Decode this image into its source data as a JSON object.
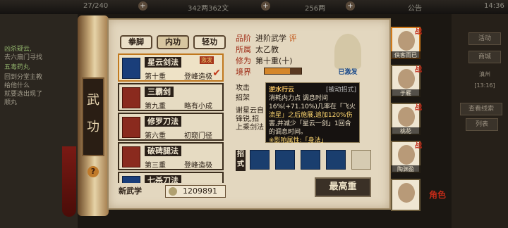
{
  "topbar": {
    "stamina": "27/240",
    "silver": "342两362文",
    "gold": "256两",
    "announce": "公告",
    "time": "14:36"
  },
  "left_quest": {
    "line1": "凶杀疑云,",
    "line2": "去六扇门寻找",
    "line3": "五毒药丸",
    "line4": "回到分堂主教",
    "line5": "给他什么",
    "line6": "就要选出现了",
    "line7": "顺丸"
  },
  "right_menu": {
    "btn1": "活动",
    "btn2": "商城",
    "btn3": "背包",
    "btn4": "查看线索",
    "btn5": "列表",
    "time": "[13:16]",
    "region": "滇州"
  },
  "scroll": {
    "title": "武功",
    "help": "?"
  },
  "tabs": [
    "拳脚",
    "内功",
    "轻功"
  ],
  "skills": [
    {
      "name": "星云剑法",
      "tier": "第十重",
      "status": "登峰造极",
      "tag": "激发",
      "color": "blue"
    },
    {
      "name": "三霸剑",
      "tier": "第九重",
      "status": "略有小成",
      "color": "red"
    },
    {
      "name": "修罗刀法",
      "tier": "第六重",
      "status": "初窥门径",
      "color": "red"
    },
    {
      "name": "破碑腿法",
      "tier": "第三重",
      "status": "登峰造极",
      "color": "red"
    },
    {
      "name": "七杀刀法",
      "tier": "",
      "status": "",
      "color": "blue"
    }
  ],
  "new_skill": "新武学",
  "currency": "1209891",
  "detail": {
    "grade_label": "品阶",
    "grade": "进阶武学",
    "grade_tag": "评",
    "school_label": "所属",
    "school": "太乙教",
    "level_label": "修为",
    "level": "第十重(十)",
    "realm_label": "境界",
    "realm_fill": 0.7,
    "avatar_label": "已激发"
  },
  "desc_text": {
    "attack_label": "攻击",
    "parry_label": "招架",
    "body1": "谢星云自",
    "body2": "锋锐,招",
    "body3": "上乘剑法"
  },
  "popup": {
    "title": "逆水行云",
    "sub": "[被动招式]",
    "l1a": "消耗内力点",
    "l1b": "调息时间",
    "l2": "16%(+71.10%)几率在「飞火",
    "l3": "流星」之后施展,追加120%伤",
    "l4": "害,并减少「星云一剑」1回合",
    "l5": "的调息时间。",
    "l6": "※影响属性:「身法」"
  },
  "moves_label": "招式",
  "max_button": "最高重",
  "party": [
    {
      "name": "侠客而已",
      "zhan": "战"
    },
    {
      "name": "于雁",
      "zhan": "战"
    },
    {
      "name": "桃花",
      "zhan": "战"
    },
    {
      "name": "陶渊盈",
      "zhan": "战"
    },
    {
      "name": "",
      "zhan": ""
    }
  ],
  "side_text": "角色"
}
